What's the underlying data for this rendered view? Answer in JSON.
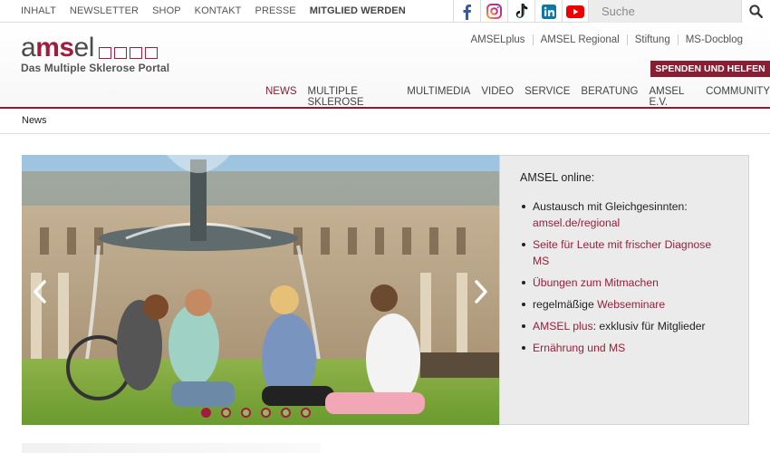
{
  "topbar": {
    "links": [
      "INHALT",
      "NEWSLETTER",
      "SHOP",
      "KONTAKT",
      "PRESSE"
    ],
    "member_link": "MITGLIED WERDEN",
    "social": [
      "facebook-icon",
      "instagram-icon",
      "tiktok-icon",
      "linkedin-icon",
      "youtube-icon"
    ],
    "search_placeholder": "Suche"
  },
  "logo": {
    "part1": "a",
    "part2": "ms",
    "part3": "el",
    "subtitle": "Das Multiple Sklerose Portal"
  },
  "header": {
    "right_links": [
      "AMSELplus",
      "AMSEL Regional",
      "Stiftung",
      "MS-Docblog"
    ],
    "donate_label": "SPENDEN UND HELFEN",
    "nav": [
      "NEWS",
      "MULTIPLE SKLEROSE",
      "MULTIMEDIA",
      "VIDEO",
      "SERVICE",
      "BERATUNG",
      "AMSEL E.V.",
      "COMMUNITY"
    ],
    "active_nav": "NEWS"
  },
  "breadcrumb": {
    "current": "News"
  },
  "slider": {
    "dot_count": 6,
    "active_dot": 1
  },
  "infobox": {
    "title": "AMSEL online:",
    "item1_text": "Austausch mit Gleichgesinnten:",
    "item1_link": "amsel.de/regional",
    "item2_link": "Seite für Leute mit frischer Diagnose MS",
    "item3_link": "Übungen zum Mitmachen",
    "item4_text": "regelmäßige ",
    "item4_link": "Webseminare",
    "item5_link": "AMSEL plus",
    "item5_text": ": exklusiv für Mitglieder",
    "item6_link": "Ernährung und MS"
  },
  "colors": {
    "brand": "#8b1d33",
    "link": "#9b1d39"
  }
}
